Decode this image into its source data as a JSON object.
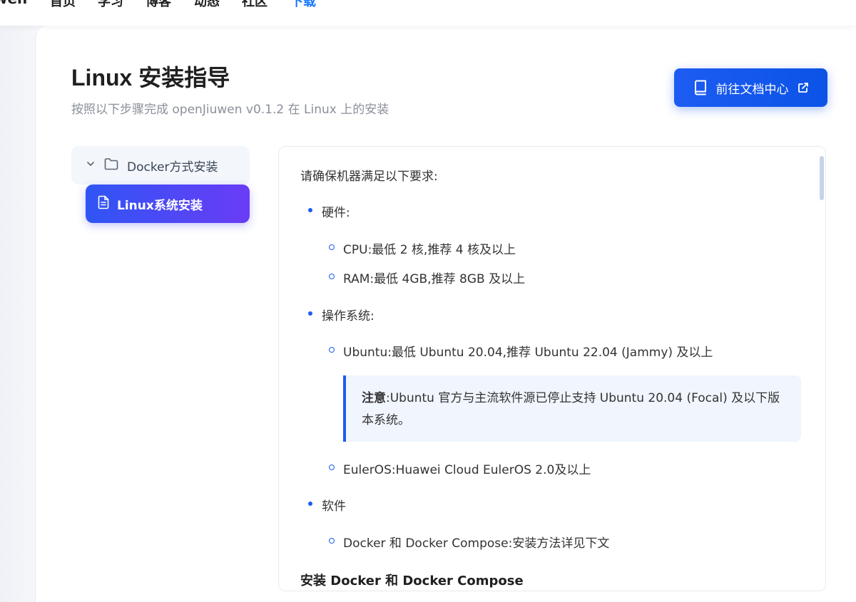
{
  "topnav": {
    "brand": "wen",
    "items": [
      {
        "label": "首页"
      },
      {
        "label": "学习"
      },
      {
        "label": "博客"
      },
      {
        "label": "动态"
      },
      {
        "label": "社区"
      },
      {
        "label": "下载"
      }
    ]
  },
  "header": {
    "title": "Linux 安装指导",
    "subtitle": "按照以下步骤完成 openJiuwen v0.1.2 在 Linux 上的安装",
    "doc_button_label": "前往文档中心"
  },
  "sidebar": {
    "folder_label": "Docker方式安装",
    "active_item_label": "Linux系统安装"
  },
  "content": {
    "intro": "请确保机器满足以下要求:",
    "hardware": {
      "label": "硬件:",
      "cpu": "CPU:最低 2 核,推荐 4 核及以上",
      "ram": "RAM:最低 4GB,推荐 8GB 及以上"
    },
    "os": {
      "label": "操作系统:",
      "ubuntu": "Ubuntu:最低 Ubuntu 20.04,推荐 Ubuntu 22.04 (Jammy) 及以上",
      "note_label": "注意",
      "note_text": ":Ubuntu 官方与主流软件源已停止支持 Ubuntu 20.04 (Focal) 及以下版本系统。",
      "euleros": "EulerOS:Huawei Cloud EulerOS 2.0及以上"
    },
    "software": {
      "label": "软件",
      "docker": "Docker 和 Docker Compose:安装方法详见下文"
    },
    "section_heading": "安装 Docker 和 Docker Compose"
  },
  "colors": {
    "accent": "#1d5cf2",
    "active_gradient_start": "#2f55f5",
    "active_gradient_end": "#6a3cf5",
    "nav_active": "#1677ff"
  },
  "icons": {
    "chevron": "chevron-down-icon",
    "folder": "folder-icon",
    "file": "file-text-icon",
    "book": "book-icon",
    "external": "external-link-icon"
  }
}
